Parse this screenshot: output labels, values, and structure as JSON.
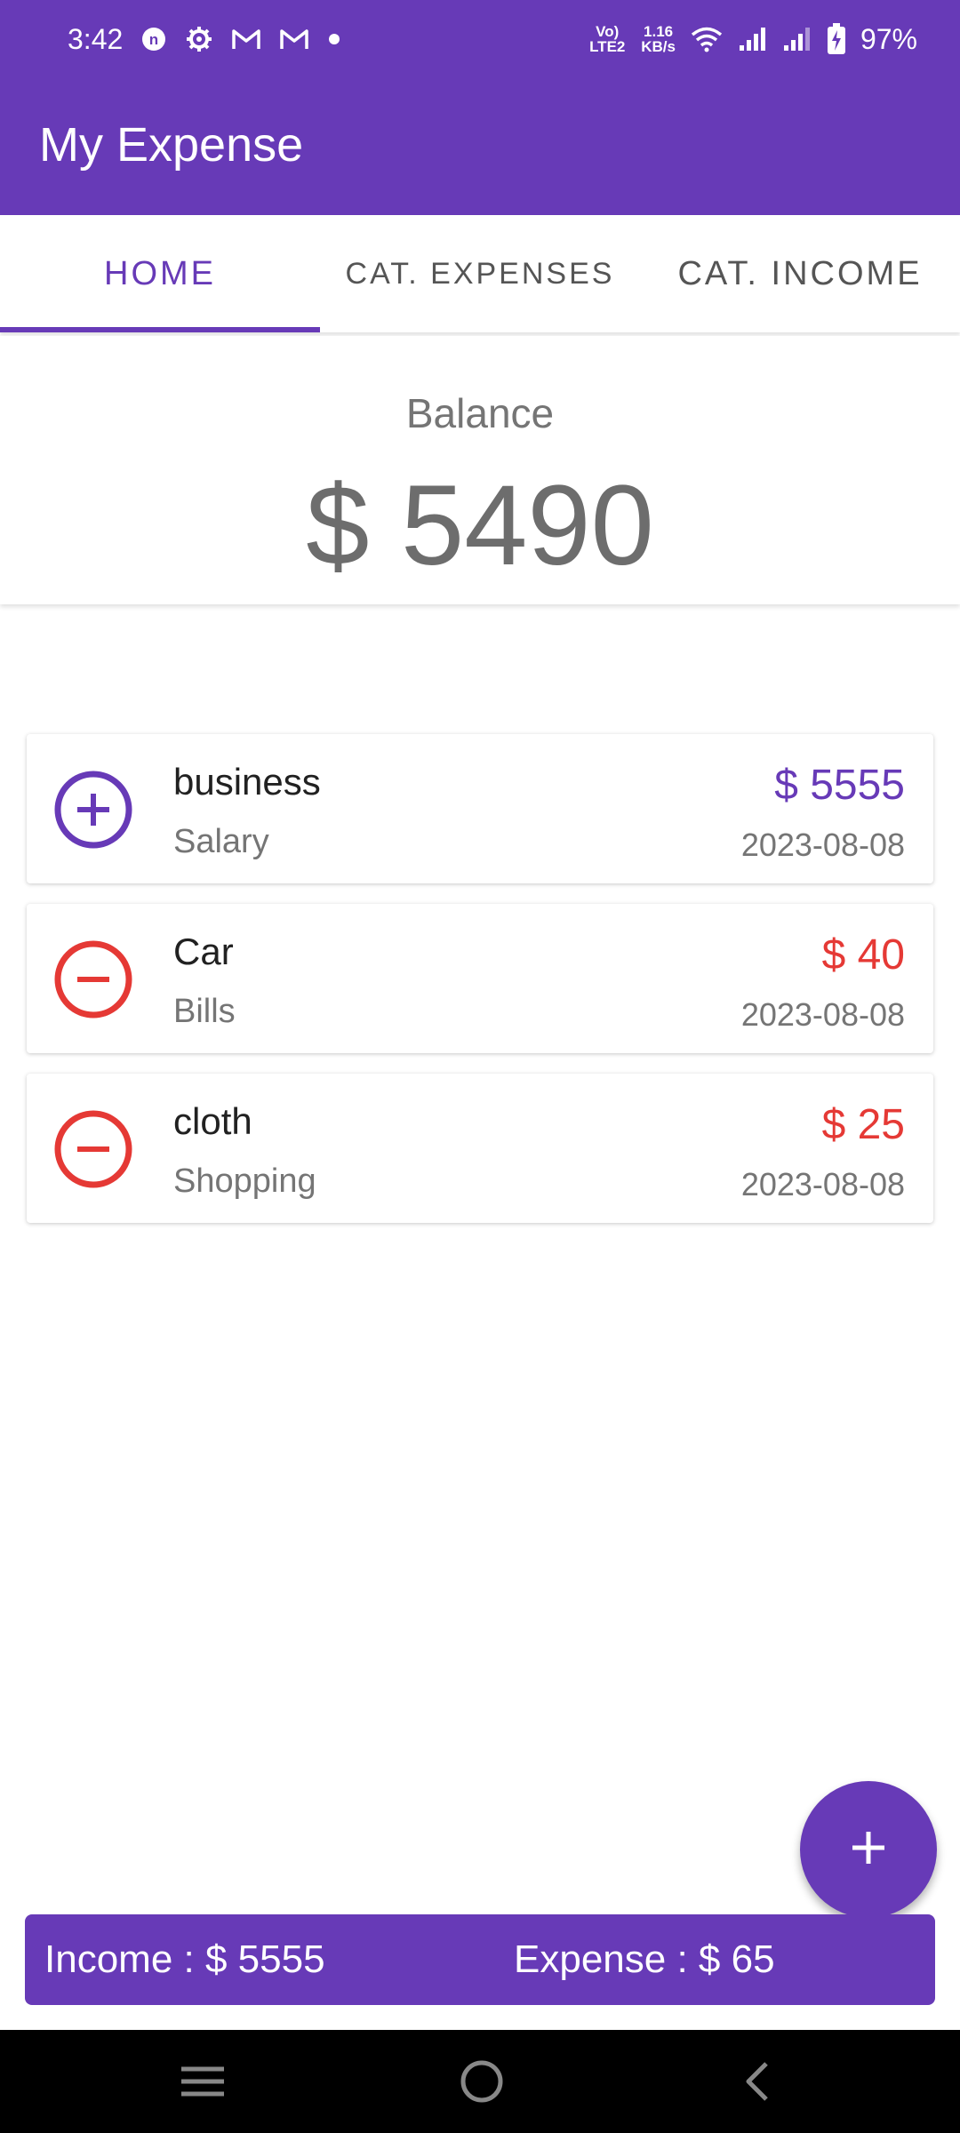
{
  "status_bar": {
    "time": "3:42",
    "network_type": "Vo) LTE2",
    "speed_value": "1.16",
    "speed_unit": "KB/s",
    "battery": "97%",
    "icons": [
      "app-notification-icon",
      "settings-gear-icon",
      "gmail-icon",
      "gmail-icon",
      "dot-icon",
      "volte-icon",
      "wifi-icon",
      "signal-icon",
      "signal-icon",
      "battery-charging-icon"
    ]
  },
  "app": {
    "title": "My Expense"
  },
  "tabs": [
    {
      "label": "HOME",
      "active": true
    },
    {
      "label": "CAT. EXPENSES",
      "active": false
    },
    {
      "label": "CAT. INCOME",
      "active": false
    }
  ],
  "balance": {
    "label": "Balance",
    "amount": "$ 5490"
  },
  "transactions": [
    {
      "type": "income",
      "icon": "plus-circle-icon",
      "title": "business",
      "category": "Salary",
      "amount": "$ 5555",
      "date": "2023-08-08"
    },
    {
      "type": "expense",
      "icon": "minus-circle-icon",
      "title": "Car",
      "category": "Bills",
      "amount": "$ 40",
      "date": "2023-08-08"
    },
    {
      "type": "expense",
      "icon": "minus-circle-icon",
      "title": "cloth",
      "category": "Shopping",
      "amount": "$ 25",
      "date": "2023-08-08"
    }
  ],
  "summary": {
    "income": "Income : $ 5555",
    "expense": "Expense : $ 65"
  },
  "fab_icon": "plus-icon",
  "nav_icons": [
    "menu-icon",
    "home-icon",
    "back-icon"
  ],
  "colors": {
    "primary": "#673ab7",
    "income": "#673ab7",
    "expense": "#e53935",
    "navbar": "#000000"
  }
}
